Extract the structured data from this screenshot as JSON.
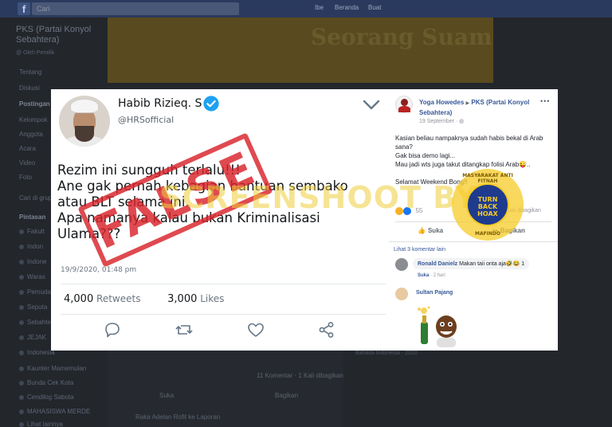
{
  "fb_background": {
    "search_placeholder": "Cari",
    "nav": [
      "Ibe",
      "Beranda",
      "Buat"
    ],
    "cover_text": "Seorang Suami",
    "page_title": "PKS (Partai Konyol Sebahtera)",
    "page_handle": "@ Oleh Pemilik",
    "sidebar": [
      "Tentang",
      "Diskusi",
      "Postingan",
      "Kelompok",
      "Anggota",
      "Acara",
      "Video",
      "Foto",
      "Cari di grup"
    ],
    "groups_heading": "Pintasan",
    "groups": [
      "Fakult",
      "Indon",
      "Indone",
      "Waras",
      "Pemuda",
      "Seputa",
      "Sebahtera",
      "JEJAK",
      "Indonesia",
      "Kaunter Mamemulan",
      "Bunda Cek Kota",
      "Cendikig Sabota",
      "MAHASISWA MERDE",
      "Lihat lainnya"
    ],
    "bottom_counts": "11 Komentar · 1 Kali dibagikan",
    "bottom_like": "Suka",
    "bottom_share": "Bagikan",
    "bottom_comment": "Raka Adelan Rofit ke Laporan",
    "right_panel": "Bahasa Indonesia · 2020"
  },
  "tweet": {
    "name": "Habib Rizieq. S",
    "handle": "@HRSofficial",
    "lines": [
      "Rezim ini sungguh terlalu!!!",
      "Ane gak pernah kebagian bantuan sembako",
      "atau BLT selama ini.",
      "Apa namanya kalau bukan Kriminalisasi",
      "Ulama???"
    ],
    "date": "19/9/2020, 01:48 pm",
    "retweets_count": "4,000",
    "retweets_label": "Retweets",
    "likes_count": "3,000",
    "likes_label": "Likes",
    "stamp": "FALSE"
  },
  "fb_post": {
    "author": "Yoga Howedes",
    "arrow": "▶",
    "group": "PKS (Partai Konyol Sebahtera)",
    "time": "19 September · ",
    "body": [
      "Kasian beliau nampaknya sudah habis bekal di Arab",
      "sana?",
      "Gak bisa demo lagi...",
      "Mau jadi wts juga takut ditangkap folisi Arab😜..",
      "",
      "Selamat Weekend Bong!!"
    ],
    "reactions_count": "55",
    "counts": "11 Komentar  1 Kali dibagikan",
    "like_label": "Suka",
    "share_label": "Bagikan",
    "more_comments": "Lihat 3 komentar lain",
    "comment1_author": "Ronald Danielz",
    "comment1_text": "Makan taii onta aja🤣😂",
    "comment1_reacts": "1",
    "comment1_like": "Suka",
    "comment1_time": " · 2 hari",
    "comment2_author": "Sultan Pajang"
  },
  "overlay": {
    "watermark": "SCREENSHOOT BY",
    "badge_top": "MASYARAKAT ANTI FITNAH",
    "badge_center_1": "TURN",
    "badge_center_2": "BACK",
    "badge_center_3": "HOAX",
    "badge_bottom": "MAFINDO"
  },
  "colors": {
    "twitter_blue": "#1da1f2",
    "fb_blue": "#365899",
    "stamp_red": "#d8232a",
    "badge_yellow": "#f6cb27"
  }
}
